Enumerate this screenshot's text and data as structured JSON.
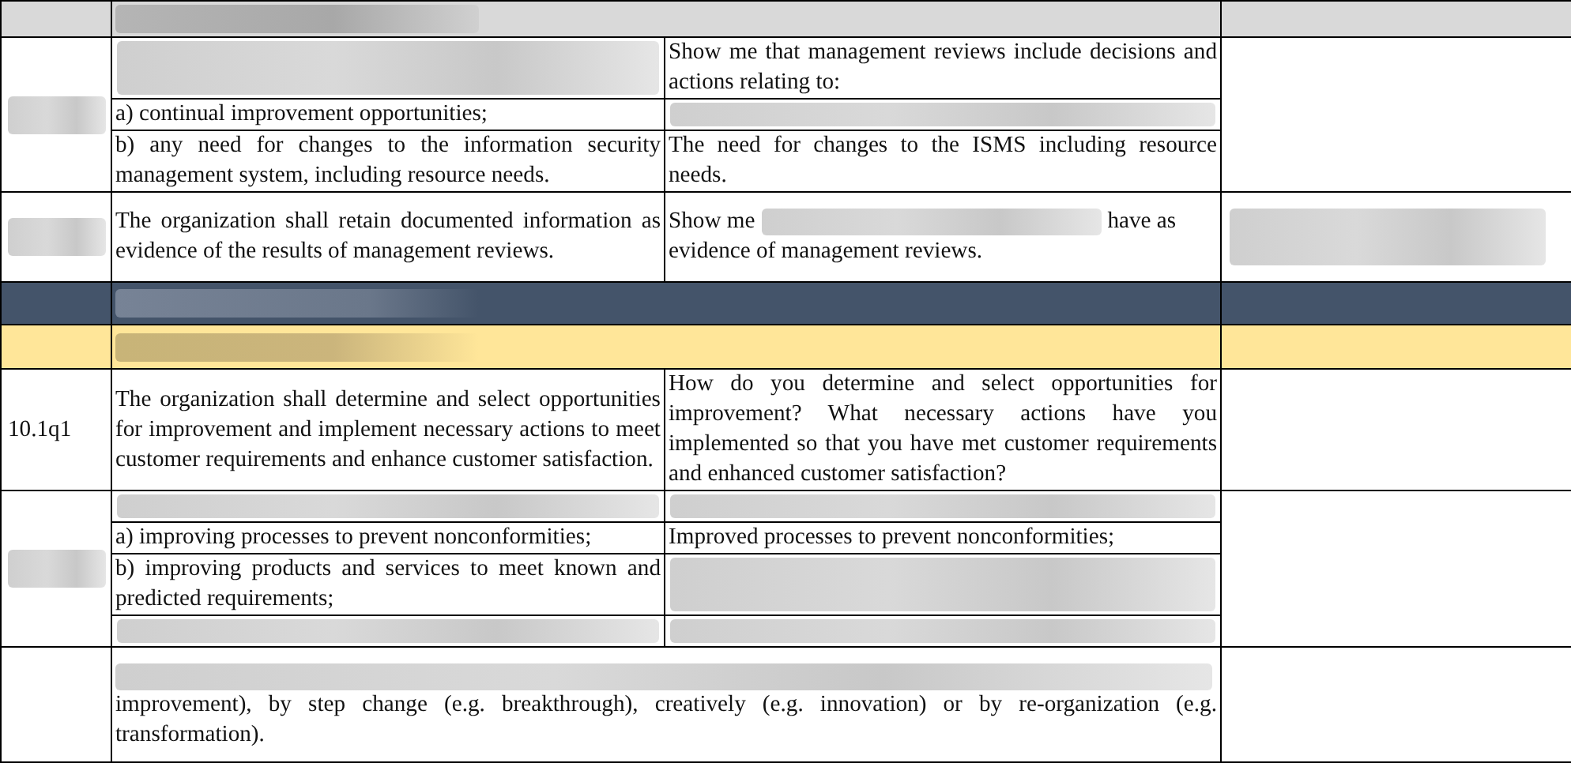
{
  "table": {
    "rows": [
      {
        "kind": "header",
        "id": [],
        "subrows": [
          {
            "combined": [
              {
                "kind": "blurred"
              }
            ]
          }
        ],
        "notes": []
      },
      {
        "kind": "item",
        "id": [
          {
            "kind": "blurred"
          }
        ],
        "subrows": [
          {
            "requirement": [
              {
                "kind": "blurred"
              }
            ],
            "question": [
              "Show me that management reviews include decisions and actions relating to:"
            ]
          },
          {
            "requirement": [
              "a) continual improvement opportunities;"
            ],
            "question": [
              {
                "kind": "blurred"
              }
            ]
          },
          {
            "requirement": [
              "b) any need for changes to the information security management system, including resource needs."
            ],
            "question": [
              "The need for changes to the ISMS including resource needs."
            ]
          }
        ],
        "notes": []
      },
      {
        "kind": "item",
        "id": [
          {
            "kind": "blurred"
          }
        ],
        "subrows": [
          {
            "requirement": [
              "The organization shall retain documented information as evidence of the results of management reviews."
            ],
            "question": [
              "Show me",
              {
                "kind": "blurred"
              },
              "have as",
              "evidence of management reviews."
            ]
          }
        ],
        "notes": [
          {
            "kind": "blurred"
          }
        ]
      },
      {
        "kind": "band_dark",
        "id": [],
        "subrows": [
          {
            "combined": [
              {
                "kind": "blurred"
              }
            ]
          }
        ],
        "notes": []
      },
      {
        "kind": "band_yellow",
        "id": [],
        "subrows": [
          {
            "combined": [
              {
                "kind": "blurred"
              }
            ]
          }
        ],
        "notes": []
      },
      {
        "kind": "item",
        "id": [
          "10.1q1"
        ],
        "subrows": [
          {
            "requirement": [
              "The organization shall determine and select opportunities for improvement and implement necessary actions to meet customer requirements and enhance customer satisfaction."
            ],
            "question": [
              "How do you determine and select opportunities for improvement? What necessary actions have you implemented so that you have met customer requirements and enhanced customer satisfaction?"
            ]
          }
        ],
        "notes": []
      },
      {
        "kind": "item",
        "id": [
          {
            "kind": "blurred"
          }
        ],
        "subrows": [
          {
            "requirement": [
              {
                "kind": "blurred"
              }
            ],
            "question": [
              {
                "kind": "blurred"
              }
            ]
          },
          {
            "requirement": [
              "a) improving processes to prevent nonconformities;"
            ],
            "question": [
              "Improved processes to prevent nonconformities;"
            ]
          },
          {
            "requirement": [
              "b) improving products and services to meet known and predicted requirements;"
            ],
            "question": [
              {
                "kind": "blurred"
              }
            ]
          },
          {
            "requirement": [
              {
                "kind": "blurred"
              }
            ],
            "question": [
              {
                "kind": "blurred"
              }
            ]
          }
        ],
        "notes": []
      },
      {
        "kind": "item",
        "id": [],
        "subrows": [
          {
            "combined": [
              {
                "kind": "blurred"
              },
              "improvement), by step change (e.g. breakthrough), creatively (e.g. innovation) or by re-organization (e.g. transformation)."
            ]
          }
        ],
        "notes": []
      }
    ]
  }
}
